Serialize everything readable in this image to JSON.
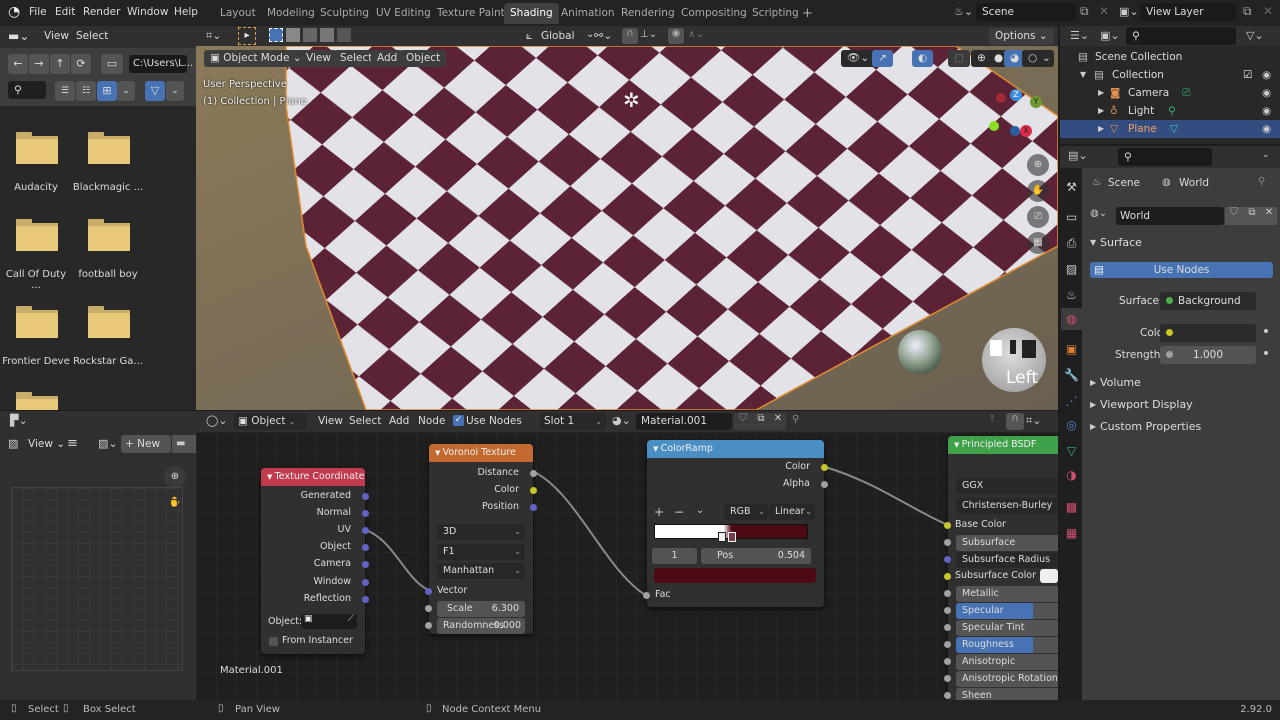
{
  "topbar": {
    "menus": [
      "File",
      "Edit",
      "Render",
      "Window",
      "Help"
    ],
    "workspaces": [
      "Layout",
      "Modeling",
      "Sculpting",
      "UV Editing",
      "Texture Paint",
      "Shading",
      "Animation",
      "Rendering",
      "Compositing",
      "Scripting"
    ],
    "active_workspace": "Shading",
    "add_workspace": "+",
    "scene": "Scene",
    "view_layer": "View Layer"
  },
  "file_browser": {
    "header_menus": [
      "View",
      "Select"
    ],
    "path": "C:\\Users\\L...",
    "folders": [
      "Audacity",
      "Blackmagic ...",
      "Call Of Duty ...",
      "football boy",
      "Frontier Deve",
      "Rockstar Ga...",
      ""
    ]
  },
  "viewport": {
    "tool_header": {
      "orientation": "Global",
      "options": "Options"
    },
    "mode": "Object Mode",
    "menus": [
      "View",
      "Select",
      "Add",
      "Object"
    ],
    "info_line1": "User Perspective",
    "info_line2": "(1) Collection | Plane",
    "gizmo_axes": {
      "x": "X",
      "y": "Y",
      "z": "Z"
    },
    "matcap_label": "Left",
    "colors": {
      "checker_dark": "#5c2336",
      "checker_light": "#e4e4ea"
    }
  },
  "outliner": {
    "root": "Scene Collection",
    "collection": "Collection",
    "items": [
      {
        "name": "Camera",
        "color": "#e09050"
      },
      {
        "name": "Light",
        "color": "#e09050"
      },
      {
        "name": "Plane",
        "color": "#e09050",
        "selected": true
      }
    ]
  },
  "properties": {
    "breadcrumb": [
      "Scene",
      "World"
    ],
    "world_name": "World",
    "surface_panel": "Surface",
    "use_nodes_label": "Use Nodes",
    "surface_label": "Surface",
    "surface_value": "Background",
    "color_label": "Color",
    "strength_label": "Strength",
    "strength_value": "1.000",
    "collapsed_panels": [
      "Volume",
      "Viewport Display",
      "Custom Properties"
    ]
  },
  "node_editor": {
    "header": {
      "type": "Object",
      "menus": [
        "View",
        "Select",
        "Add",
        "Node"
      ],
      "use_nodes": "Use Nodes",
      "use_nodes_checked": true,
      "slot": "Slot 1",
      "material": "Material.001"
    },
    "material_label": "Material.001",
    "nodes": {
      "texture_coordinate": {
        "title": "Texture Coordinate",
        "color": "#c13a4e",
        "outputs": [
          "Generated",
          "Normal",
          "UV",
          "Object",
          "Camera",
          "Window",
          "Reflection"
        ],
        "object_label": "Object:",
        "from_instancer": "From Instancer"
      },
      "voronoi": {
        "title": "Voronoi Texture",
        "color": "#c46a30",
        "outputs": [
          "Distance",
          "Color",
          "Position"
        ],
        "dimensions": "3D",
        "feature": "F1",
        "metric": "Manhattan",
        "vector_input": "Vector",
        "scale_label": "Scale",
        "scale_value": "6.300",
        "randomness_label": "Randomness",
        "randomness_value": "0.000"
      },
      "colorramp": {
        "title": "ColorRamp",
        "color": "#4a8fc4",
        "outputs": [
          "Color",
          "Alpha"
        ],
        "color_mode": "RGB",
        "interpolation": "Linear",
        "stop_index": "1",
        "pos_label": "Pos",
        "pos_value": "0.504",
        "stop_color": "#4e0a14",
        "input": "Fac"
      },
      "principled": {
        "title": "Principled BSDF",
        "color": "#3fa24a",
        "distribution": "GGX",
        "subsurface_method": "Christensen-Burley",
        "inputs": [
          "Base Color",
          "Subsurface",
          "Subsurface Radius",
          "Subsurface Color",
          "Metallic",
          "Specular",
          "Specular Tint",
          "Roughness",
          "Anisotropic",
          "Anisotropic Rotation",
          "Sheen"
        ]
      }
    }
  },
  "image_editor": {
    "view_menu": "View",
    "new_button": "New"
  },
  "statusbar": {
    "hints": [
      "Select",
      "Box Select",
      "Pan View",
      "Node Context Menu"
    ],
    "version": "2.92.0"
  }
}
